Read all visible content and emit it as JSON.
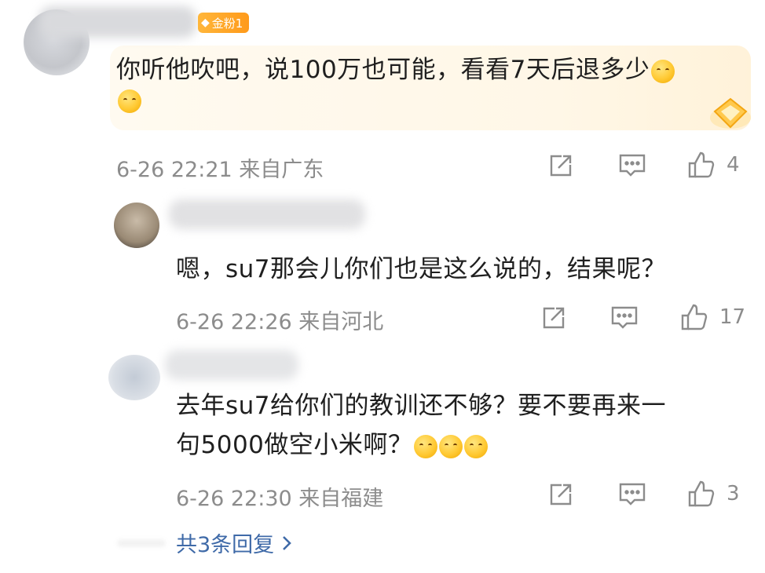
{
  "badge": {
    "label": "金粉1"
  },
  "comments": [
    {
      "text_lines": [
        "你听他吹吧，说100万也可能，看看7天后退多少",
        ""
      ],
      "meta": "6-26 22:21 来自广东",
      "likes": "4"
    },
    {
      "text_lines": [
        "嗯，su7那会儿你们也是这么说的，结果呢？"
      ],
      "meta": "6-26 22:26 来自河北",
      "likes": "17"
    },
    {
      "text_lines": [
        "去年su7给你们的教训还不够？要不要再来一",
        "句5000做空小米啊？"
      ],
      "meta": "6-26 22:30 来自福建",
      "likes": "3"
    }
  ],
  "replies_link": "共3条回复",
  "icons": [
    "share-icon",
    "comment-icon",
    "like-icon",
    "chevron-right-icon",
    "emoji-icon",
    "crown-badge-icon"
  ],
  "colors": {
    "meta": "#8c8c8c",
    "link": "#3f6aa8",
    "badge": "#ff9a1a",
    "gold_bg": "#fff7e7"
  }
}
